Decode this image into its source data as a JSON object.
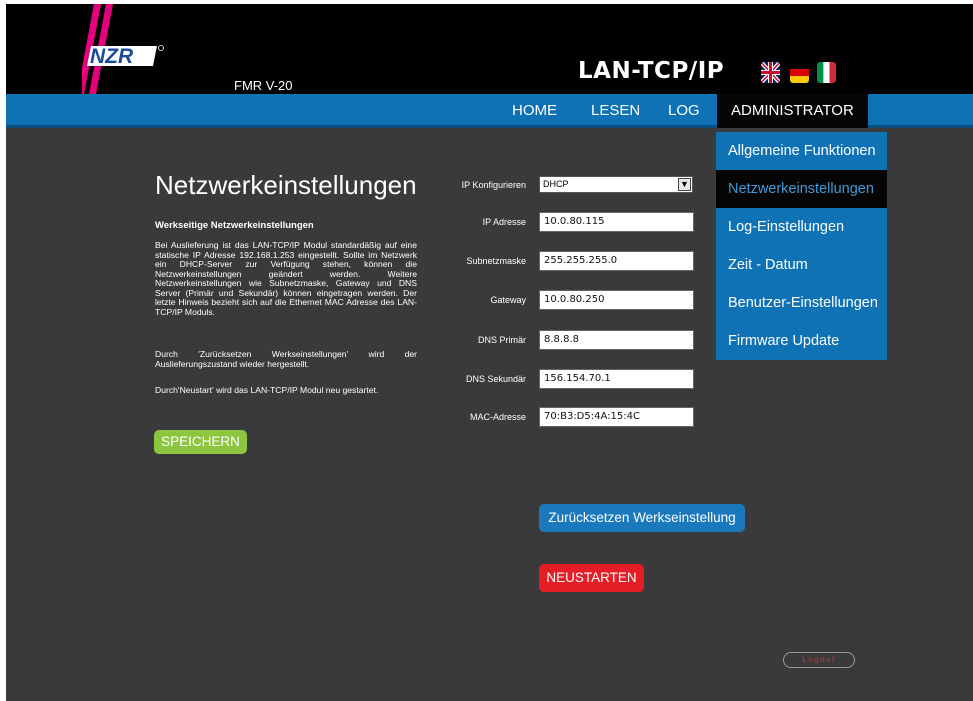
{
  "header": {
    "logo_text": "NZR",
    "product": "FMR V-20",
    "module_title": "LAN-TCP/IP"
  },
  "nav": {
    "home": "HOME",
    "lesen": "LESEN",
    "log": "LOG",
    "admin": "ADMINISTRATOR"
  },
  "dropdown": [
    "Allgemeine Funktionen",
    "Netzwerkeinstellungen",
    "Log-Einstellungen",
    "Zeit - Datum",
    "Benutzer-Einstellungen",
    "Firmware Update"
  ],
  "main": {
    "title": "Netzwerkeinstellungen",
    "subtitle": "Werkseitige Netzwerkeinstellungen",
    "paragraph1": "Bei Auslieferung ist das LAN-TCP/IP Modul standardäßig auf eine statische IP Adresse 192.168.1.253 eingestellt. Sollte im Netzwerk ein DHCP-Server zur Verfügung stehen, können die Netzwerkeinstellungen geändert werden. Weitere Netzwerkeinstellungen wie Subnetzmaske, Gateway und DNS Server (Primär und Sekundär) können eingetragen werden. Der letzte Hinweis bezieht sich auf die Ethernet MAC Adresse des LAN-TCP/IP Moduls.",
    "paragraph2": "Durch 'Zurücksetzen Werkseinstellungen' wird der Auslieferungszustand wieder hergestellt.",
    "paragraph3": "Durch'Neustart' wird das LAN-TCP/IP Modul neu gestartet.",
    "save_button": "SPEICHERN"
  },
  "form": {
    "ip_config_label": "IP Konfigurieren",
    "ip_config_value": "DHCP",
    "ip_label": "IP Adresse",
    "ip_value": "10.0.80.115",
    "subnet_label": "Subnetzmaske",
    "subnet_value": "255.255.255.0",
    "gateway_label": "Gateway",
    "gateway_value": "10.0.80.250",
    "dns1_label": "DNS Primär",
    "dns1_value": "8.8.8.8",
    "dns2_label": "DNS Sekundär",
    "dns2_value": "156.154.70.1",
    "mac_label": "MAC-Adresse",
    "mac_value": "70:B3:D5:4A:15:4C"
  },
  "actions": {
    "reset": "Zurücksetzen Werkseinstellung",
    "restart": "NEUSTARTEN",
    "logout": "Logout"
  },
  "colors": {
    "nav_blue": "#0e72b5",
    "save_green": "#8cc63f",
    "restart_red": "#e41e26",
    "logo_magenta": "#e5007e",
    "logo_blue": "#1b4a9c"
  }
}
